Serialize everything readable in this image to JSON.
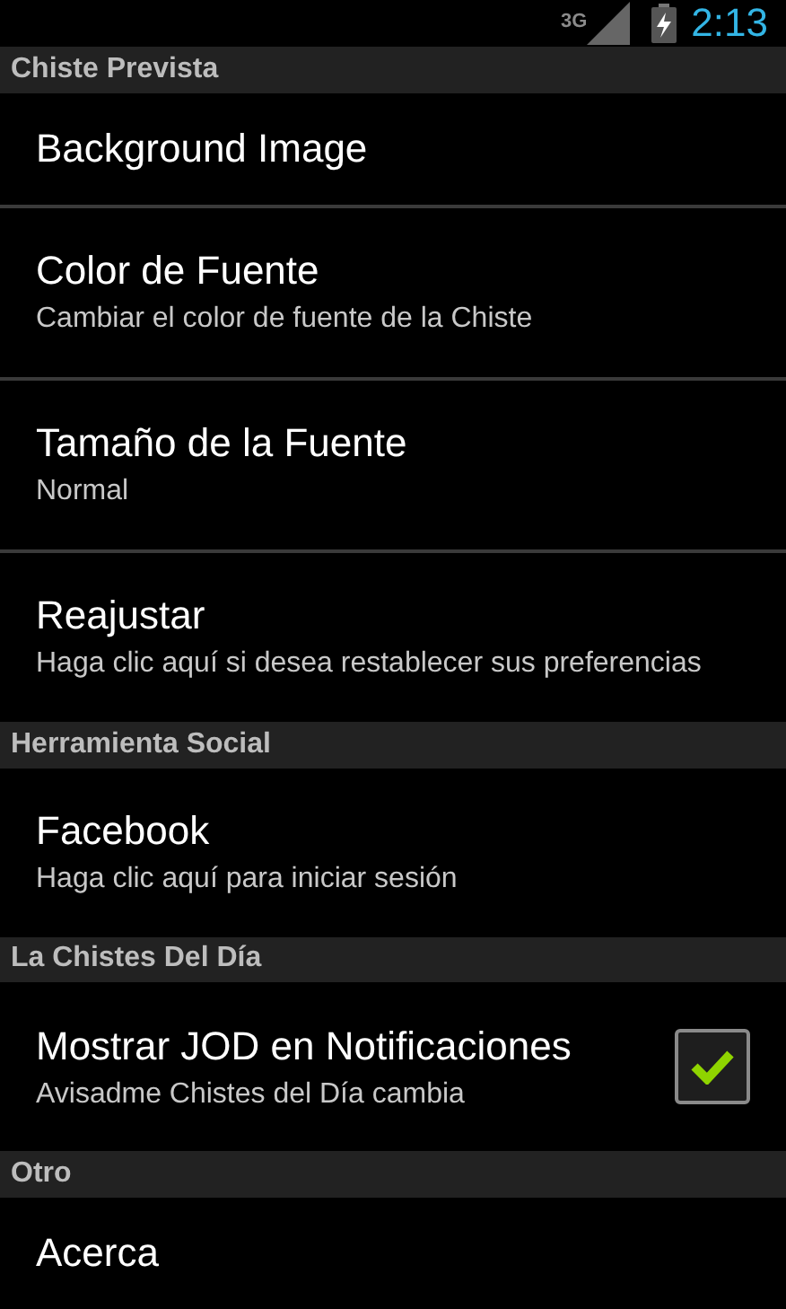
{
  "status_bar": {
    "network": "3G",
    "time": "2:13"
  },
  "sections": [
    {
      "title": "Chiste Prevista",
      "items": [
        {
          "kind": "plain",
          "title": "Background Image"
        },
        {
          "kind": "plain",
          "title": "Color de Fuente",
          "summary": "Cambiar el color de fuente de la Chiste"
        },
        {
          "kind": "plain",
          "title": "Tamaño de la Fuente",
          "summary": "Normal"
        },
        {
          "kind": "plain",
          "title": "Reajustar",
          "summary": "Haga clic aquí si desea restablecer sus preferencias"
        }
      ]
    },
    {
      "title": "Herramienta Social",
      "items": [
        {
          "kind": "plain",
          "title": "Facebook",
          "summary": "Haga clic aquí para iniciar sesión"
        }
      ]
    },
    {
      "title": "La Chistes Del Día",
      "items": [
        {
          "kind": "checkbox",
          "title": "Mostrar JOD en Notificaciones",
          "summary": "Avisadme Chistes del Día cambia",
          "checked": true
        }
      ]
    },
    {
      "title": "Otro",
      "items": [
        {
          "kind": "plain",
          "title": "Acerca"
        }
      ]
    }
  ]
}
